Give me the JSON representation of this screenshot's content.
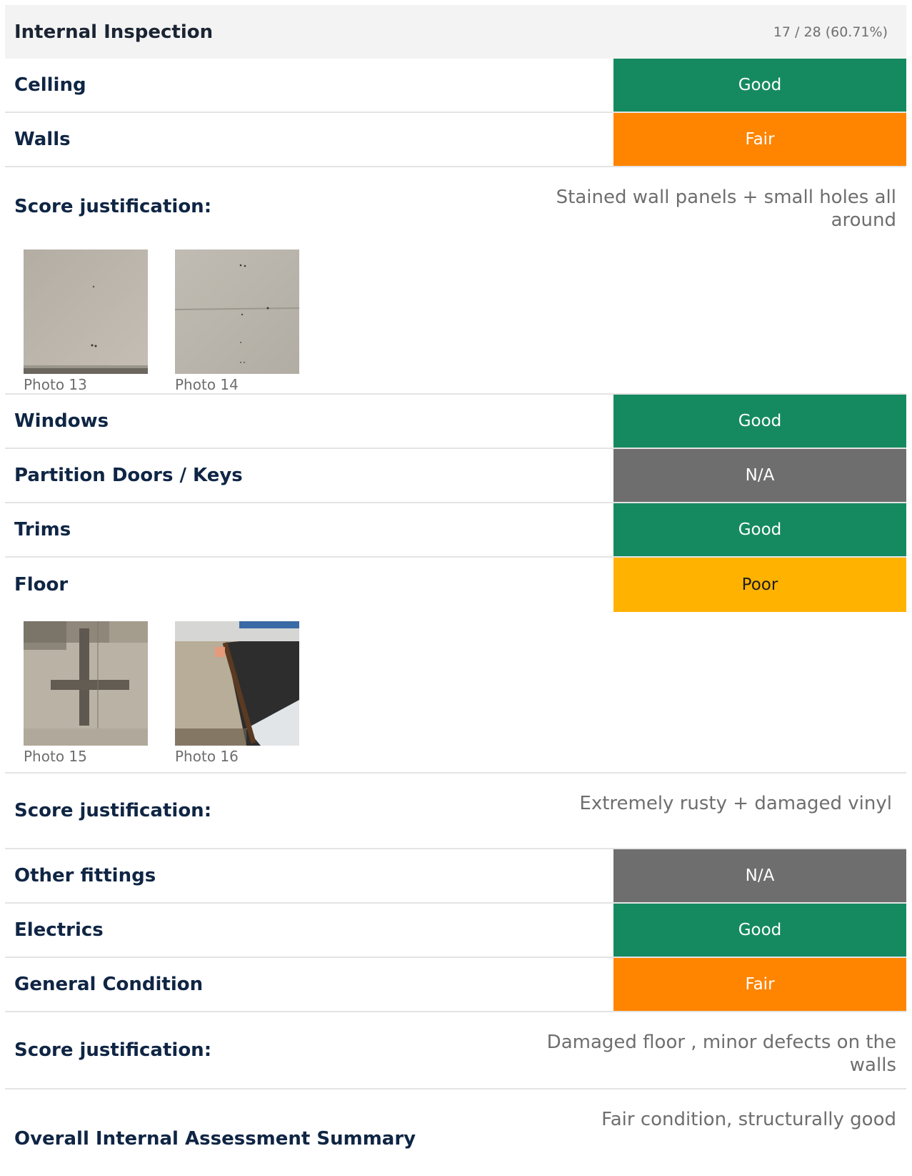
{
  "section": {
    "title": "Internal Inspection",
    "progress": "17 / 28 (60.71%)"
  },
  "items": {
    "ceiling": {
      "label": "Celling",
      "rating": "Good"
    },
    "walls": {
      "label": "Walls",
      "rating": "Fair"
    },
    "walls_just": {
      "label": "Score justification:",
      "value": "Stained wall panels + small holes all around"
    },
    "walls_photos": [
      {
        "caption": "Photo 13"
      },
      {
        "caption": "Photo 14"
      }
    ],
    "windows": {
      "label": "Windows",
      "rating": "Good"
    },
    "partition": {
      "label": "Partition Doors / Keys",
      "rating": "N/A"
    },
    "trims": {
      "label": "Trims",
      "rating": "Good"
    },
    "floor": {
      "label": "Floor",
      "rating": "Poor"
    },
    "floor_photos": [
      {
        "caption": "Photo 15"
      },
      {
        "caption": "Photo 16"
      }
    ],
    "floor_just": {
      "label": "Score justification:",
      "value": "Extremely rusty + damaged vinyl"
    },
    "other": {
      "label": "Other fittings",
      "rating": "N/A"
    },
    "electrics": {
      "label": "Electrics",
      "rating": "Good"
    },
    "general": {
      "label": "General Condition",
      "rating": "Fair"
    },
    "general_just": {
      "label": "Score justification:",
      "value": "Damaged floor , minor defects on the walls"
    },
    "summary": {
      "label": "Overall Internal Assessment Summary",
      "value": "Fair condition, structurally good"
    }
  },
  "colors": {
    "good": "#158a60",
    "fair": "#ff8400",
    "na": "#6e6e6e",
    "poor": "#ffb300"
  }
}
